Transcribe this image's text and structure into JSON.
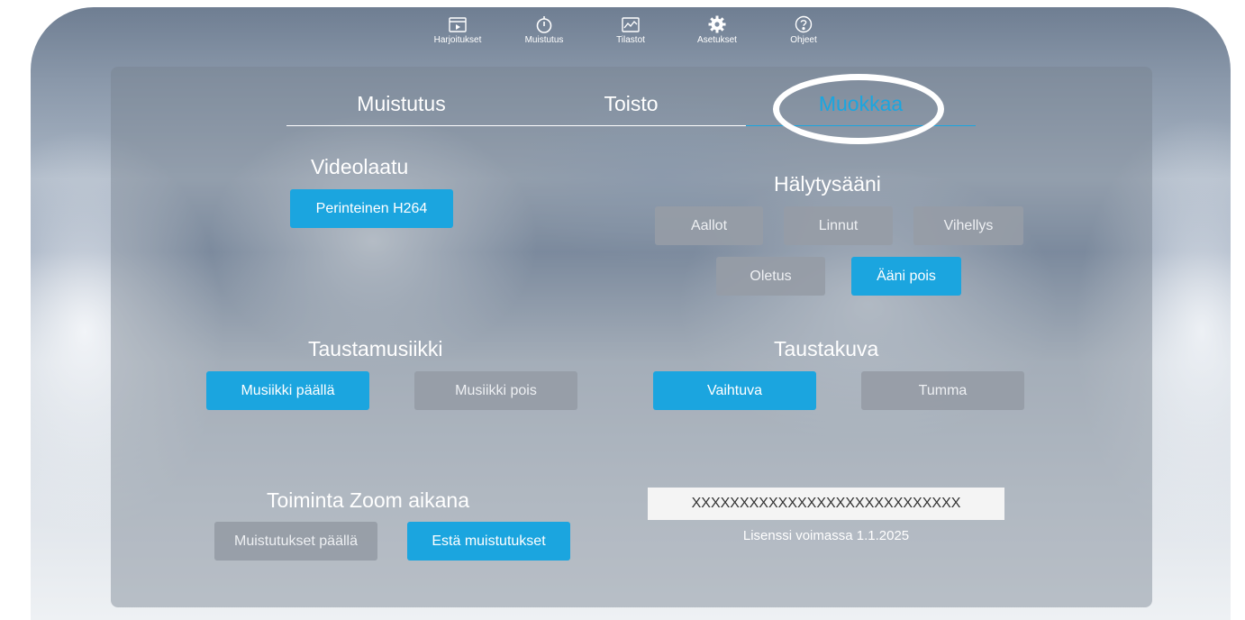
{
  "nav": {
    "items": [
      {
        "label": "Harjoitukset",
        "icon": "exercise-video-icon"
      },
      {
        "label": "Muistutus",
        "icon": "timer-icon"
      },
      {
        "label": "Tilastot",
        "icon": "stats-chart-icon"
      },
      {
        "label": "Asetukset",
        "icon": "gear-icon"
      },
      {
        "label": "Ohjeet",
        "icon": "help-icon"
      }
    ]
  },
  "tabs": [
    {
      "label": "Muistutus",
      "active": false
    },
    {
      "label": "Toisto",
      "active": false
    },
    {
      "label": "Muokkaa",
      "active": true
    }
  ],
  "video_quality": {
    "heading": "Videolaatu",
    "button": "Perinteinen H264"
  },
  "alarm_sound": {
    "heading": "Hälytysääni",
    "options": [
      "Aallot",
      "Linnut",
      "Vihellys",
      "Oletus",
      "Ääni pois"
    ],
    "selected": "Ääni pois"
  },
  "background_music": {
    "heading": "Taustamusiikki",
    "on_label": "Musiikki päällä",
    "off_label": "Musiikki pois",
    "selected": "on"
  },
  "background_image": {
    "heading": "Taustakuva",
    "option_changing": "Vaihtuva",
    "option_dark": "Tumma",
    "selected": "Vaihtuva"
  },
  "zoom_behavior": {
    "heading": "Toiminta Zoom aikana",
    "option_on": "Muistutukset päällä",
    "option_block": "Estä muistutukset",
    "selected": "Estä muistutukset"
  },
  "license": {
    "key_value": "XXXXXXXXXXXXXXXXXXXXXXXXXXXX",
    "valid_text": "Lisenssi voimassa 1.1.2025"
  },
  "colors": {
    "accent": "#1ba5df",
    "inactive_button": "#969ca6",
    "text": "#ffffff"
  }
}
